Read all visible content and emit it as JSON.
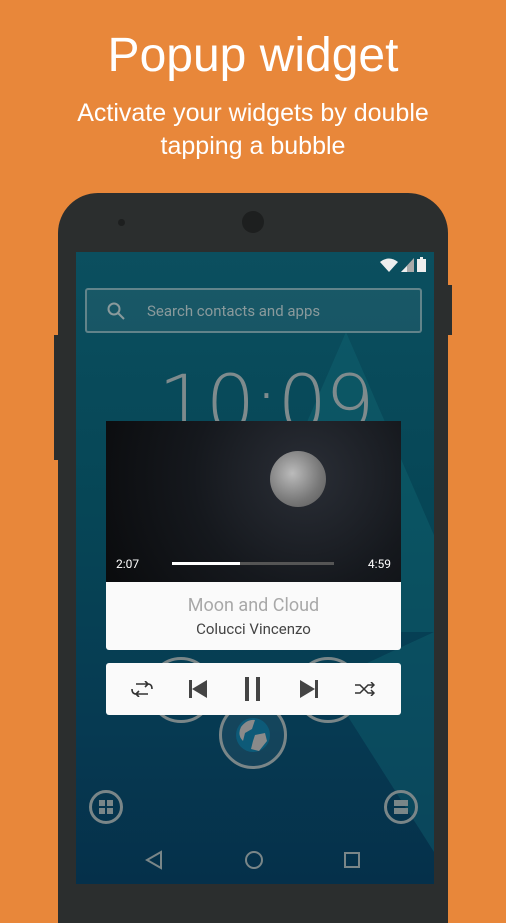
{
  "header": {
    "title": "Popup widget",
    "subtitle_line1": "Activate your widgets by double",
    "subtitle_line2": "tapping a bubble"
  },
  "search": {
    "placeholder": "Search contacts and apps"
  },
  "clock": {
    "time": "10:09"
  },
  "player": {
    "elapsed": "2:07",
    "duration": "4:59",
    "progress": 0.42,
    "song": "Moon and Cloud",
    "artist": "Colucci Vincenzo"
  },
  "colors": {
    "background": "#E8873A",
    "phone": "#2b2e2e",
    "screen": "#064656"
  }
}
